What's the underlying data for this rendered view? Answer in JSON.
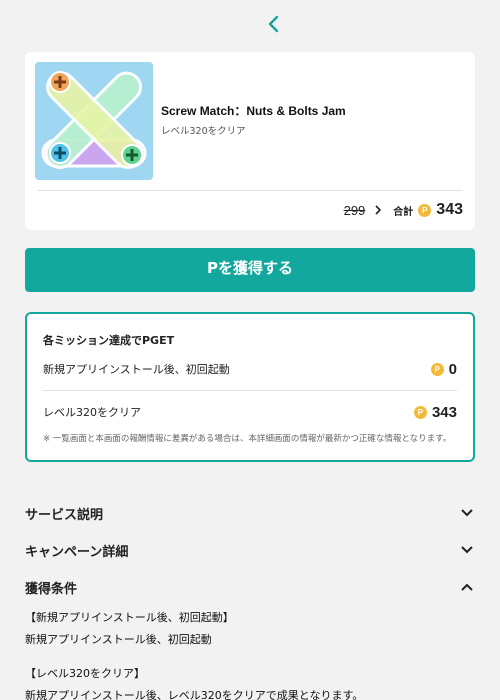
{
  "header": {
    "back_icon": "chevron-left-icon",
    "accent": "#13a89e"
  },
  "app": {
    "title": "Screw Match：Nuts & Bolts Jam",
    "subtitle": "レベル320をクリア",
    "old_price": "299",
    "total_label": "合計",
    "total_value": "343",
    "coin_symbol": "P"
  },
  "cta": {
    "label": "Pを獲得する"
  },
  "mission": {
    "title": "各ミッション達成でPGET",
    "items": [
      {
        "label": "新規アプリインストール後、初回起動",
        "points": "0"
      },
      {
        "label": "レベル320をクリア",
        "points": "343"
      }
    ],
    "note": "※ 一覧画面と本画面の報酬情報に差異がある場合は、本詳細画面の情報が最新かつ正確な情報となります。"
  },
  "sections": [
    {
      "label": "サービス説明",
      "expanded": false
    },
    {
      "label": "キャンペーン詳細",
      "expanded": false
    },
    {
      "label": "獲得条件",
      "expanded": true
    }
  ],
  "conditions": [
    "【新規アプリインストール後、初回起動】",
    "新規アプリインストール後、初回起動",
    "【レベル320をクリア】",
    "新規アプリインストール後、レベル320をクリアで成果となります。"
  ]
}
